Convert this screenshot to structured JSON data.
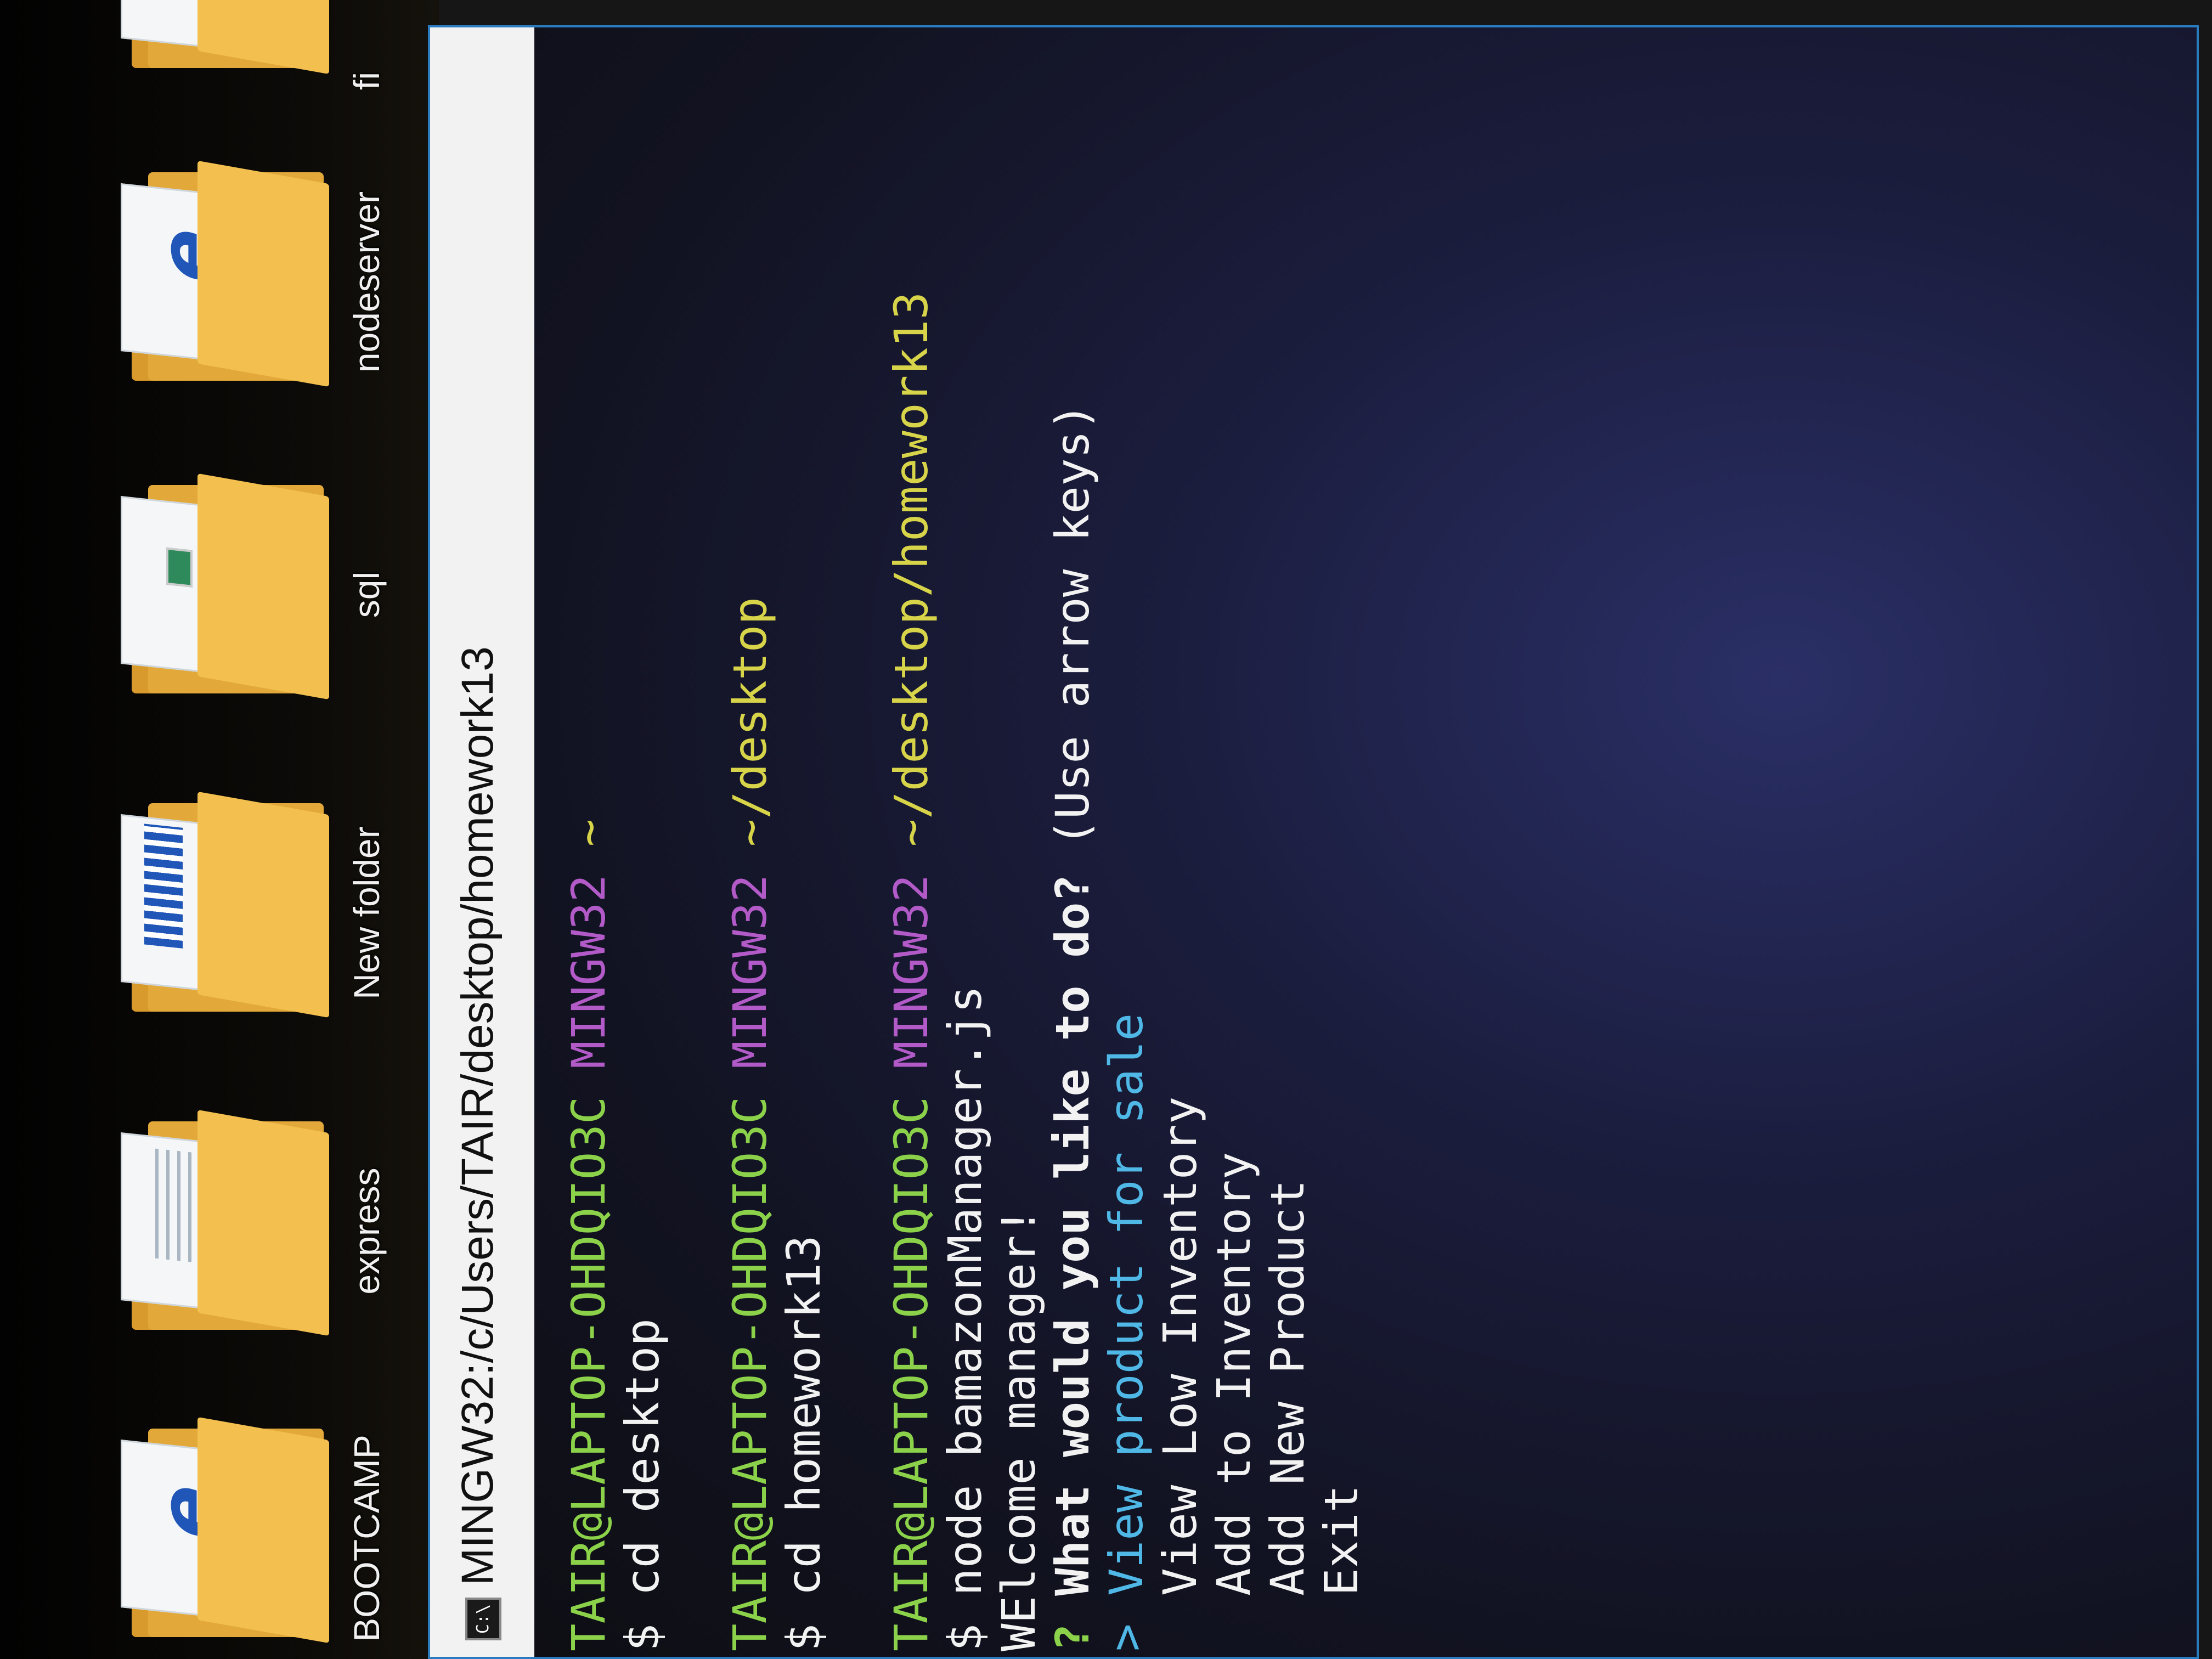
{
  "desktop": {
    "icons": [
      {
        "label": "BOOTCAMP",
        "icon": "folder-ie-icon"
      },
      {
        "label": "express",
        "icon": "folder-icon"
      },
      {
        "label": "New folder",
        "icon": "folder-icon"
      },
      {
        "label": "sql",
        "icon": "folder-icon"
      },
      {
        "label": "nodeserver",
        "icon": "folder-ie-icon"
      },
      {
        "label": "fi",
        "icon": "folder-icon"
      }
    ]
  },
  "window": {
    "title": "MINGW32:/c/Users/TAIR/desktop/homework13",
    "icon": "terminal-icon"
  },
  "terminal": {
    "prompt1": {
      "user_host": "TAIR@LAPTOP-OHDQIO3C",
      "env": "MINGW32",
      "path": "~"
    },
    "cmd1": "$ cd desktop",
    "prompt2": {
      "user_host": "TAIR@LAPTOP-OHDQIO3C",
      "env": "MINGW32",
      "path": "~/desktop"
    },
    "cmd2": "$ cd homework13",
    "prompt3": {
      "user_host": "TAIR@LAPTOP-OHDQIO3C",
      "env": "MINGW32",
      "path": "~/desktop/homework13"
    },
    "cmd3": "$ node bamazonManager.js",
    "welcome": "WElcome manager!",
    "question_mark": "?",
    "question": "What would you like to do?",
    "hint": "(Use arrow keys)",
    "pointer": ">",
    "selected_option": "View product for sale",
    "options": [
      "View Low Inventory",
      "Add to Inventory",
      "Add New Product",
      "Exit"
    ]
  },
  "colors": {
    "user_host": "#8bd24a",
    "env": "#b25ac8",
    "path": "#d7d44a",
    "selected": "#4fb8e6",
    "window_border": "#2a7cc0"
  }
}
